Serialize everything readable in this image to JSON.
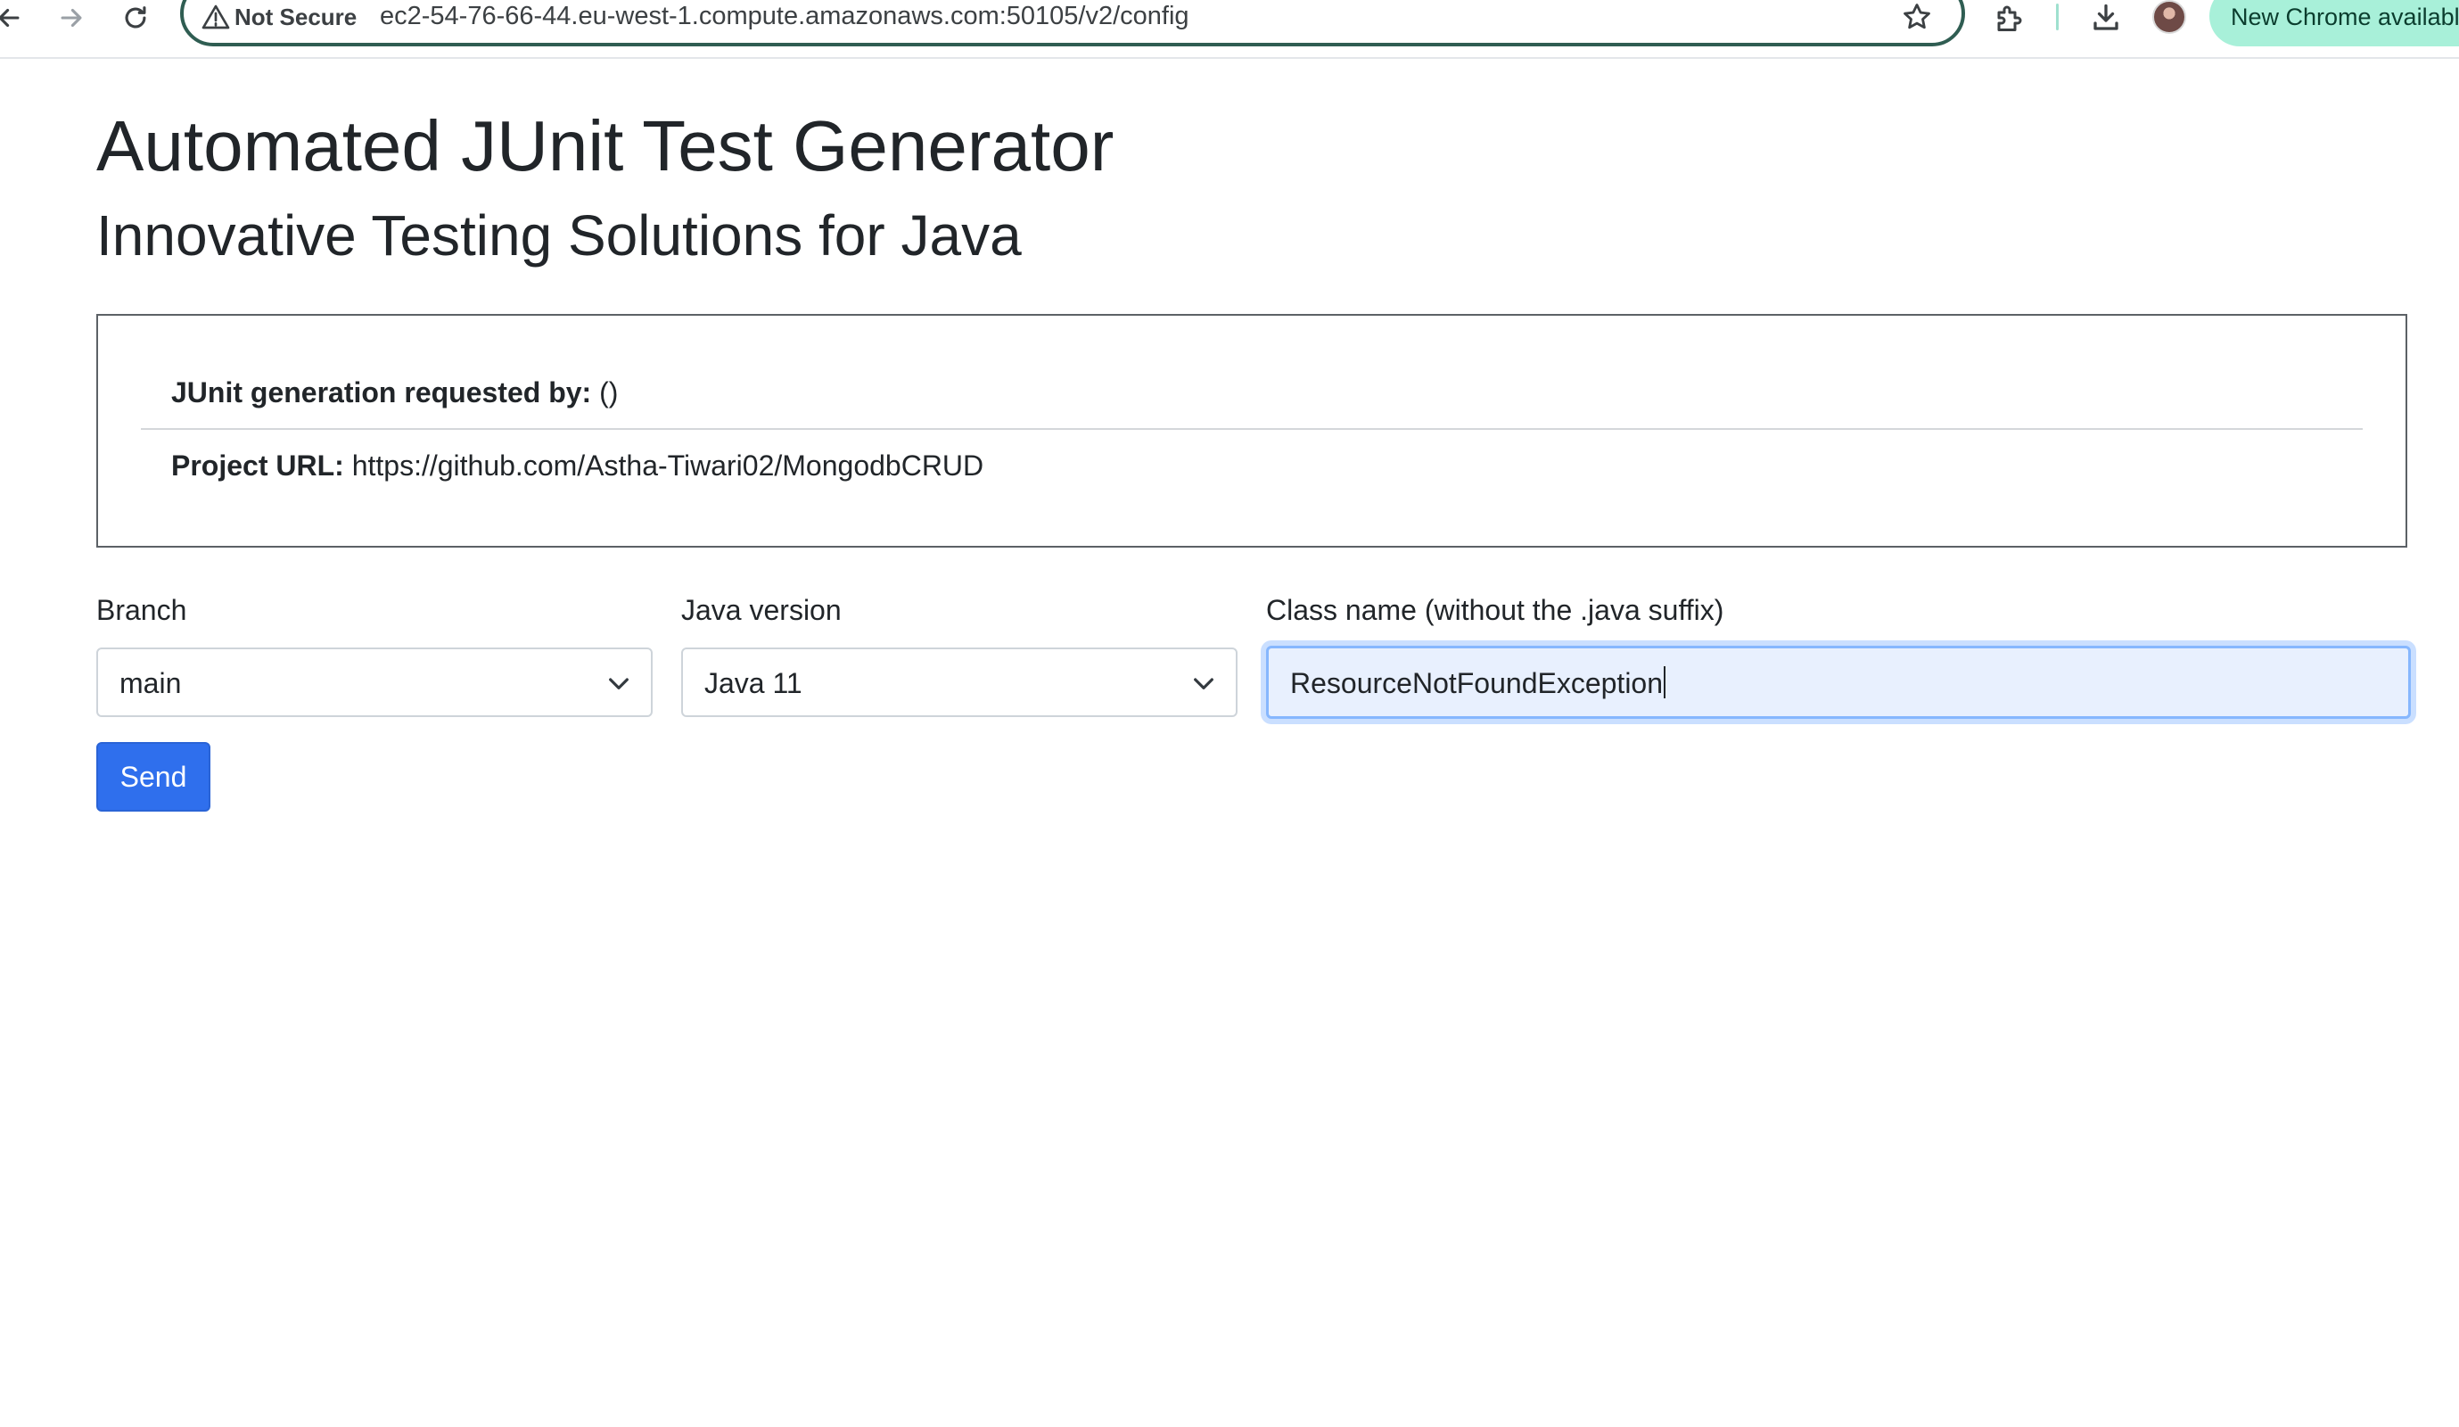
{
  "browser": {
    "security_label": "Not Secure",
    "url": "ec2-54-76-66-44.eu-west-1.compute.amazonaws.com:50105/v2/config",
    "update_label": "New Chrome available",
    "icons": [
      "back-arrow-icon",
      "forward-arrow-icon",
      "reload-icon",
      "warning-icon",
      "star-icon",
      "extensions-icon",
      "download-icon"
    ]
  },
  "page": {
    "title": "Automated JUnit Test Generator",
    "subtitle": "Innovative Testing Solutions for Java"
  },
  "info": {
    "requested_by_label": "JUnit generation requested by:",
    "requested_by_value": "()",
    "project_url_label": "Project URL:",
    "project_url_value": "https://github.com/Astha-Tiwari02/MongodbCRUD"
  },
  "form": {
    "branch_label": "Branch",
    "branch_value": "main",
    "java_label": "Java version",
    "java_value": "Java 11",
    "class_label": "Class name (without the .java suffix)",
    "class_value": "ResourceNotFoundException",
    "send_label": "Send"
  },
  "colors": {
    "primary_button": "#2f6fed",
    "focus_ring": "#86b7fe",
    "update_pill": "#a8f0d9"
  }
}
